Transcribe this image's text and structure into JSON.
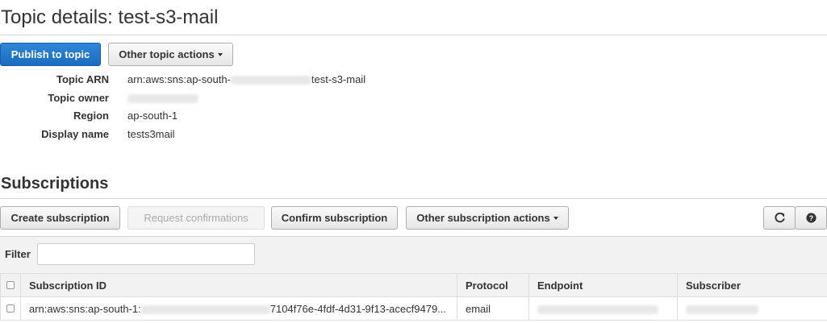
{
  "header": {
    "title": "Topic details: test-s3-mail",
    "publish_label": "Publish to topic",
    "other_actions_label": "Other topic actions"
  },
  "details": [
    {
      "label": "Topic ARN",
      "value_prefix": "arn:aws:sns:ap-south-",
      "value_suffix": "test-s3-mail"
    },
    {
      "label": "Topic owner",
      "value_prefix": "",
      "value_suffix": ""
    },
    {
      "label": "Region",
      "value_prefix": "ap-south-1",
      "value_suffix": ""
    },
    {
      "label": "Display name",
      "value_prefix": "tests3mail",
      "value_suffix": ""
    }
  ],
  "subscriptions": {
    "title": "Subscriptions",
    "toolbar": {
      "create_label": "Create subscription",
      "request_label": "Request confirmations",
      "confirm_label": "Confirm subscription",
      "other_label": "Other subscription actions",
      "refresh_icon": "refresh-icon",
      "help_icon": "help-icon"
    },
    "filter": {
      "label": "Filter",
      "value": "",
      "placeholder": ""
    },
    "columns": [
      "Subscription ID",
      "Protocol",
      "Endpoint",
      "Subscriber"
    ],
    "rows": [
      {
        "id_prefix": "arn:aws:sns:ap-south-1:",
        "id_suffix": "7104f76e-4fdf-4d31-9f13-acecf9479...",
        "protocol": "email"
      }
    ]
  },
  "colors": {
    "primary": "#1a6bc0",
    "border": "#d5d5d5",
    "header_bg": "#f2f2f2"
  }
}
